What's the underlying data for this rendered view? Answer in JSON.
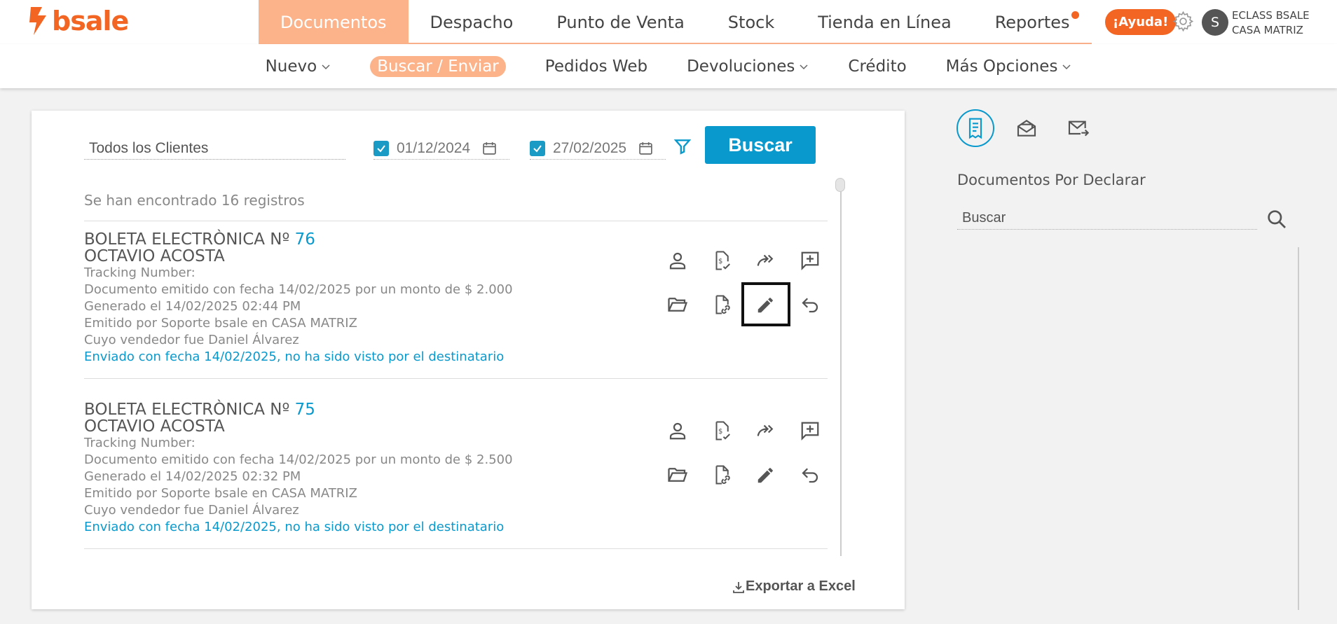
{
  "brand": {
    "logo_text": "bsale",
    "accent": "#f26522",
    "primary": "#0a99cc"
  },
  "mainnav": [
    {
      "label": "Documentos",
      "active": true
    },
    {
      "label": "Despacho"
    },
    {
      "label": "Punto de Venta"
    },
    {
      "label": "Stock"
    },
    {
      "label": "Tienda en Línea"
    },
    {
      "label": "Reportes",
      "badge": true
    }
  ],
  "header": {
    "help_label": "¡Ayuda!",
    "avatar_initial": "S",
    "company_line1": "ECLASS BSALE",
    "company_line2": "CASA MATRIZ"
  },
  "subnav": [
    {
      "label": "Nuevo",
      "dropdown": true
    },
    {
      "label": "Buscar / Enviar",
      "active": true
    },
    {
      "label": "Pedidos Web"
    },
    {
      "label": "Devoluciones",
      "dropdown": true
    },
    {
      "label": "Crédito"
    },
    {
      "label": "Más Opciones",
      "dropdown": true
    }
  ],
  "search": {
    "client_value": "Todos los Clientes",
    "date_from": "01/12/2024",
    "date_to": "27/02/2025",
    "button_label": "Buscar"
  },
  "results": {
    "count_text": "Se han encontrado 16 registros",
    "documents": [
      {
        "title": "BOLETA ELECTRÒNICA Nº ",
        "number": "76",
        "client": "OCTAVIO ACOSTA",
        "tracking": "Tracking Number:",
        "emitted": "Documento emitido con fecha 14/02/2025 por un monto de $ 2.000",
        "generated": "Generado el 14/02/2025 02:44 PM",
        "issuer": "Emitido por Soporte bsale en CASA MATRIZ",
        "seller": "Cuyo vendedor fue Daniel Álvarez",
        "sent": "Enviado con fecha 14/02/2025, no ha sido visto por el destinatario"
      },
      {
        "title": "BOLETA ELECTRÒNICA Nº ",
        "number": "75",
        "client": "OCTAVIO ACOSTA",
        "tracking": "Tracking Number:",
        "emitted": "Documento emitido con fecha 14/02/2025 por un monto de $ 2.500",
        "generated": "Generado el 14/02/2025 02:32 PM",
        "issuer": "Emitido por Soporte bsale en CASA MATRIZ",
        "seller": "Cuyo vendedor fue Daniel Álvarez",
        "sent": "Enviado con fecha 14/02/2025, no ha sido visto por el destinatario"
      }
    ],
    "export_label": "Exportar a Excel"
  },
  "side": {
    "title": "Documentos Por Declarar",
    "search_placeholder": "Buscar"
  }
}
